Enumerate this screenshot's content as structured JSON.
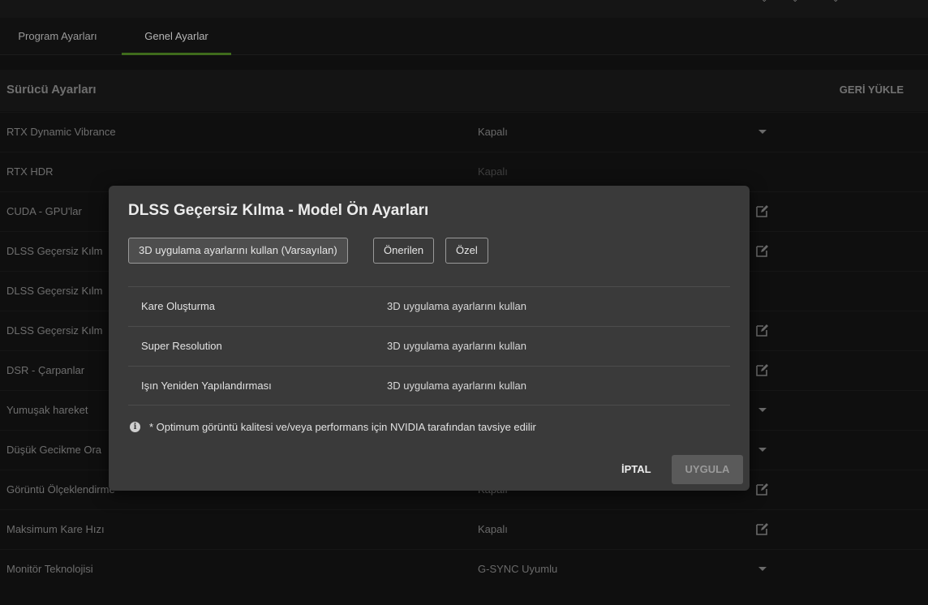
{
  "tabs": [
    {
      "label": "Program Ayarları"
    },
    {
      "label": "Genel Ayarlar"
    }
  ],
  "section": {
    "title": "Sürücü Ayarları",
    "reset_label": "GERİ YÜKLE"
  },
  "rows": [
    {
      "label": "RTX Dynamic Vibrance",
      "value": "Kapalı",
      "control": "dropdown"
    },
    {
      "label": "RTX HDR",
      "value": "Kapalı",
      "control": "none"
    },
    {
      "label": "CUDA - GPU'lar",
      "value": "",
      "control": "edit"
    },
    {
      "label": "DLSS Geçersiz Kılm",
      "value": "",
      "control": "edit"
    },
    {
      "label": "DLSS Geçersiz Kılm",
      "value": "",
      "control": "none"
    },
    {
      "label": "DLSS Geçersiz Kılm",
      "value": "",
      "control": "edit"
    },
    {
      "label": "DSR - Çarpanlar",
      "value": "",
      "control": "edit"
    },
    {
      "label": "Yumuşak hareket",
      "value": "",
      "control": "dropdown"
    },
    {
      "label": "Düşük Gecikme Ora",
      "value": "",
      "control": "dropdown"
    },
    {
      "label": "Görüntü Ölçeklendirme",
      "value": "Kapalı",
      "control": "edit"
    },
    {
      "label": "Maksimum Kare Hızı",
      "value": "Kapalı",
      "control": "edit"
    },
    {
      "label": "Monitör Teknolojisi",
      "value": "G-SYNC Uyumlu",
      "control": "dropdown"
    }
  ],
  "modal": {
    "title": "DLSS Geçersiz Kılma - Model Ön Ayarları",
    "presets": [
      {
        "label": "3D uygulama ayarlarını kullan (Varsayılan)",
        "selected": true
      },
      {
        "label": "Önerilen",
        "selected": false
      },
      {
        "label": "Özel",
        "selected": false
      }
    ],
    "settings": [
      {
        "name": "Kare Oluşturma",
        "value": "3D uygulama ayarlarını kullan"
      },
      {
        "name": "Super Resolution",
        "value": "3D uygulama ayarlarını kullan"
      },
      {
        "name": "Işın Yeniden Yapılandırması",
        "value": "3D uygulama ayarlarını kullan"
      }
    ],
    "note": "* Optimum görüntü kalitesi ve/veya performans için NVIDIA tarafından tavsiye edilir",
    "cancel_label": "İPTAL",
    "apply_label": "UYGULA"
  }
}
